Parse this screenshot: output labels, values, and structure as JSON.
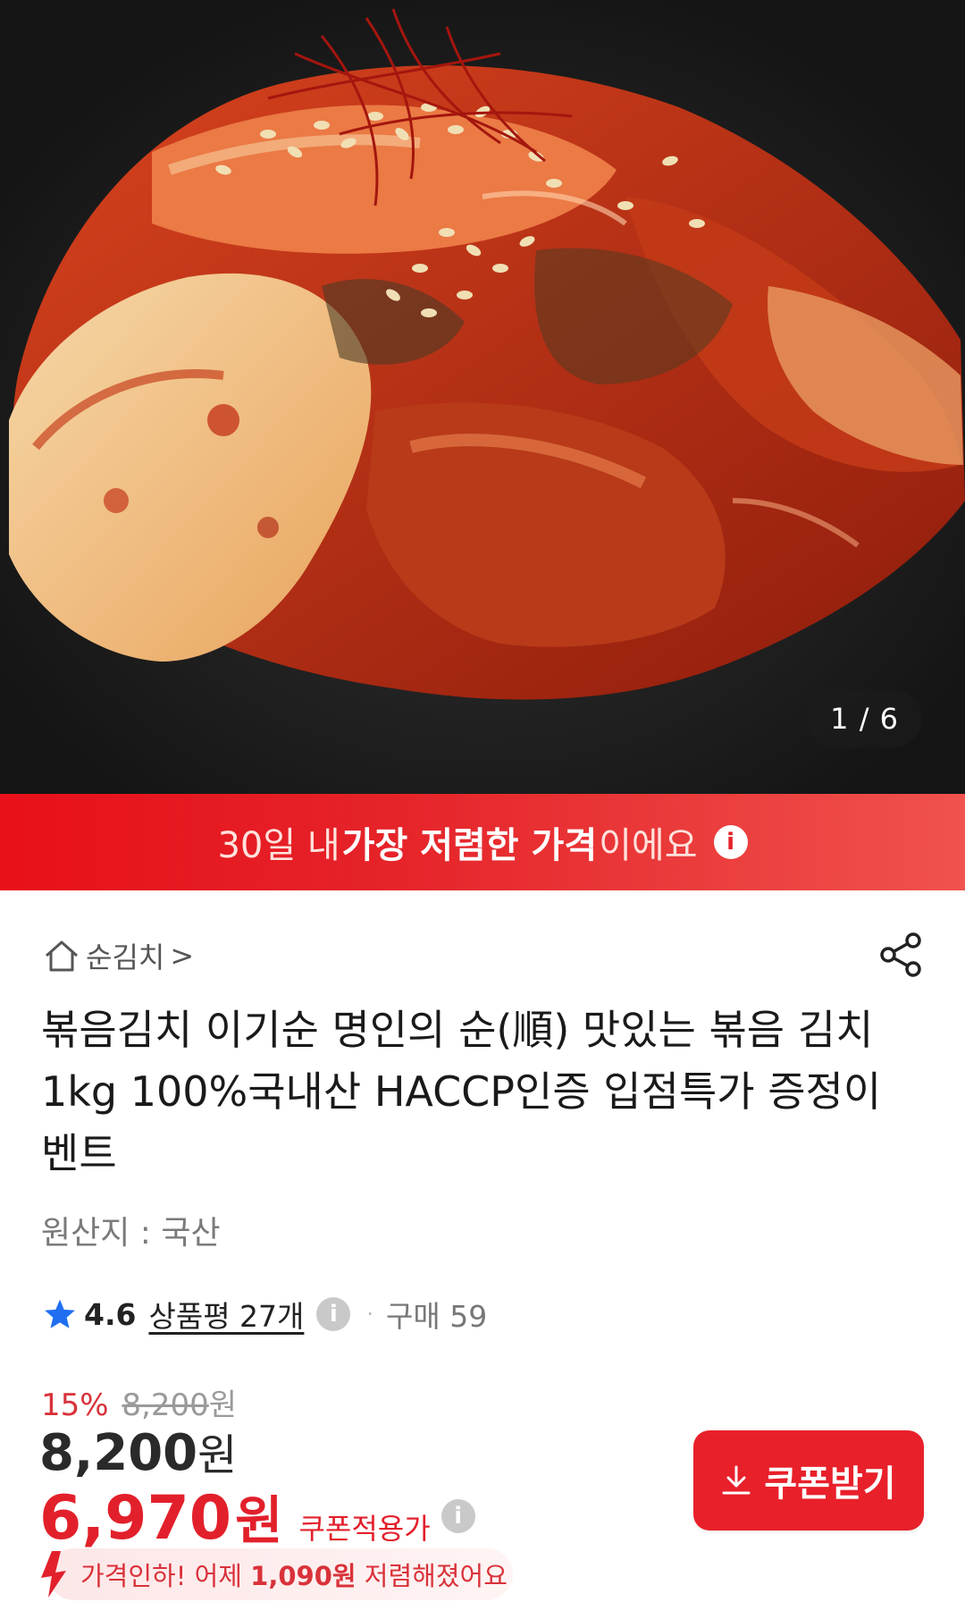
{
  "gallery": {
    "counter": "1 / 6"
  },
  "banner": {
    "prefix": "30일 내 ",
    "highlight": "가장 저렴한 가격",
    "suffix": "이에요"
  },
  "breadcrumb": {
    "category": "순김치",
    "chevron": ">"
  },
  "product": {
    "title": "볶음김치 이기순 명인의 순(順) 맛있는 볶음 김치 1kg 100%국내산 HACCP인증 입점특가 증정이벤트",
    "origin": "원산지 : 국산"
  },
  "rating": {
    "score": "4.6",
    "reviews_label": "상품평 27개",
    "separator": "·",
    "purchases_label": "구매 59"
  },
  "pricing": {
    "discount_percent": "15%",
    "original_price": "8,200",
    "original_unit": "원",
    "price": "8,200",
    "price_unit": "원",
    "coupon_price": "6,970",
    "coupon_unit": "원",
    "coupon_price_label": "쿠폰적용가"
  },
  "coupon_button": {
    "label": "쿠폰받기"
  },
  "price_drop": {
    "prefix": "가격인하! 어제 ",
    "amount": "1,090원",
    "suffix": " 저렴해졌어요"
  },
  "icons": {
    "info": "info-icon",
    "home": "home-icon",
    "share": "share-icon",
    "star": "star-icon",
    "download": "download-icon",
    "price-drop": "price-drop-arrow-icon"
  },
  "colors": {
    "accent_red": "#e8202a",
    "star_blue": "#1f6ff0"
  }
}
